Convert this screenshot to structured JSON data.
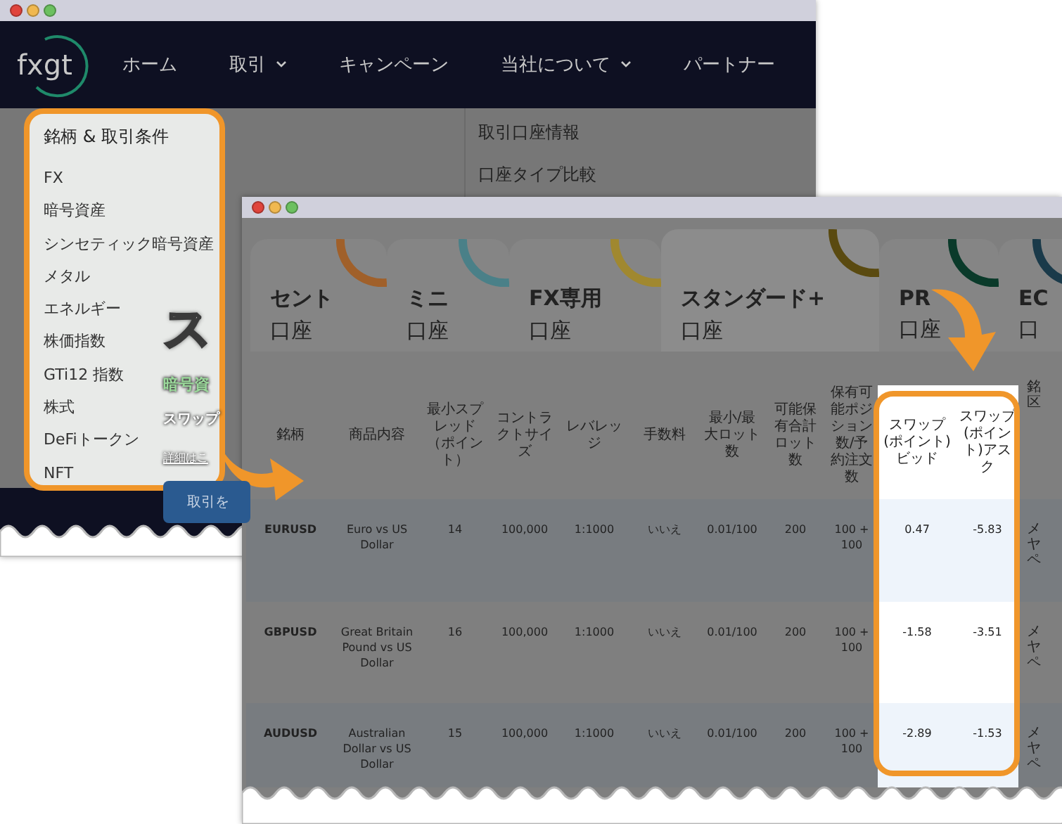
{
  "back_window": {
    "logo": "fxgt",
    "nav": [
      {
        "label": "ホーム",
        "has_dropdown": false
      },
      {
        "label": "取引",
        "has_dropdown": true
      },
      {
        "label": "キャンペーン",
        "has_dropdown": false
      },
      {
        "label": "当社について",
        "has_dropdown": true
      },
      {
        "label": "パートナー",
        "has_dropdown": false
      }
    ],
    "menu": {
      "heading": "銘柄 & 取引条件",
      "items": [
        "FX",
        "暗号資産",
        "シンセティック暗号資産",
        "メタル",
        "エネルギー",
        "株価指数",
        "GTi12 指数",
        "株式",
        "DeFiトークン",
        "NFT"
      ]
    },
    "menu_right": [
      "取引口座情報",
      "口座タイプ比較"
    ],
    "hero": {
      "title": "ス",
      "subtitle": "暗号資",
      "text": "スワップ",
      "link": "詳細はこ",
      "button": "取引を"
    }
  },
  "front_window": {
    "tabs": [
      {
        "title": "セント",
        "subtitle": "口座",
        "color": "#a0602a",
        "selected": false
      },
      {
        "title": "ミニ",
        "subtitle": "口座",
        "color": "#4a8088",
        "selected": false
      },
      {
        "title": "FX専用",
        "subtitle": "口座",
        "color": "#a08830",
        "selected": false
      },
      {
        "title": "スタンダード+",
        "subtitle": "口座",
        "color": "#5a4a10",
        "selected": true
      },
      {
        "title": "PR",
        "subtitle": "口座",
        "color": "#0a3a2a",
        "selected": false
      },
      {
        "title": "EC",
        "subtitle": "口",
        "color": "#1a3a4a",
        "selected": false
      }
    ],
    "table": {
      "columns": [
        {
          "label": "銘柄",
          "highlighted": false
        },
        {
          "label": "商品内容",
          "highlighted": false
        },
        {
          "label": "最小スプレッド（ポイント）",
          "highlighted": false
        },
        {
          "label": "コントラクトサイズ",
          "highlighted": false
        },
        {
          "label": "レバレッジ",
          "highlighted": false
        },
        {
          "label": "手数料",
          "highlighted": false
        },
        {
          "label": "最小/最大ロット数",
          "highlighted": false
        },
        {
          "label": "可能保有合計ロット数",
          "highlighted": false
        },
        {
          "label": "保有可能ポジション数/予約注文数",
          "highlighted": false
        },
        {
          "label": "スワップ(ポイント)ビッド",
          "highlighted": true
        },
        {
          "label": "スワップ(ポイント)アスク",
          "highlighted": true
        },
        {
          "label": "銘区",
          "highlighted": false
        }
      ],
      "rows": [
        {
          "cells": [
            "EURUSD",
            "Euro vs US Dollar",
            "14",
            "100,000",
            "1:1000",
            "いいえ",
            "0.01/100",
            "200",
            "100 + 100",
            "0.47",
            "-5.83",
            "メヤペ"
          ]
        },
        {
          "cells": [
            "GBPUSD",
            "Great Britain Pound vs US Dollar",
            "16",
            "100,000",
            "1:1000",
            "いいえ",
            "0.01/100",
            "200",
            "100 + 100",
            "-1.58",
            "-3.51",
            "メヤペ"
          ]
        },
        {
          "cells": [
            "AUDUSD",
            "Australian Dollar vs US Dollar",
            "15",
            "100,000",
            "1:1000",
            "いいえ",
            "0.01/100",
            "200",
            "100 + 100",
            "-2.89",
            "-1.53",
            "メヤペ"
          ]
        }
      ]
    }
  }
}
